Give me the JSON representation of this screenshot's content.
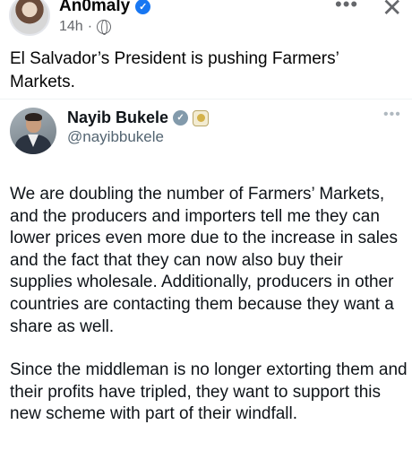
{
  "post": {
    "author_name": "An0maly",
    "time": "14h",
    "separator": "·",
    "more_glyph": "•••",
    "close_glyph": "✕",
    "caption": "El Salvador’s President is pushing Farmers’ Markets."
  },
  "tweet": {
    "author_name": "Nayib Bukele",
    "handle": "@nayibbukele",
    "more_glyph": "•••",
    "paragraphs": [
      "We are doubling the number of Farmers’ Markets, and the producers and importers tell me they can lower prices even more due to the increase in sales and the fact that they can now also buy their supplies wholesale. Additionally, producers in other countries are contacting them because they want a share as well.",
      "Since the middleman is no longer extorting them and their profits have tripled, they want to support this new scheme with part of their windfall."
    ]
  },
  "icons": {
    "fb_verified": "verified-badge-icon",
    "privacy": "globe-icon",
    "tw_verified": "verified-badge-icon",
    "tw_affiliate": "government-seal-icon"
  },
  "colors": {
    "fb_blue": "#1877f2",
    "tw_gray_badge": "#829aab",
    "secondary_text": "#65676b",
    "tw_handle": "#536471"
  }
}
